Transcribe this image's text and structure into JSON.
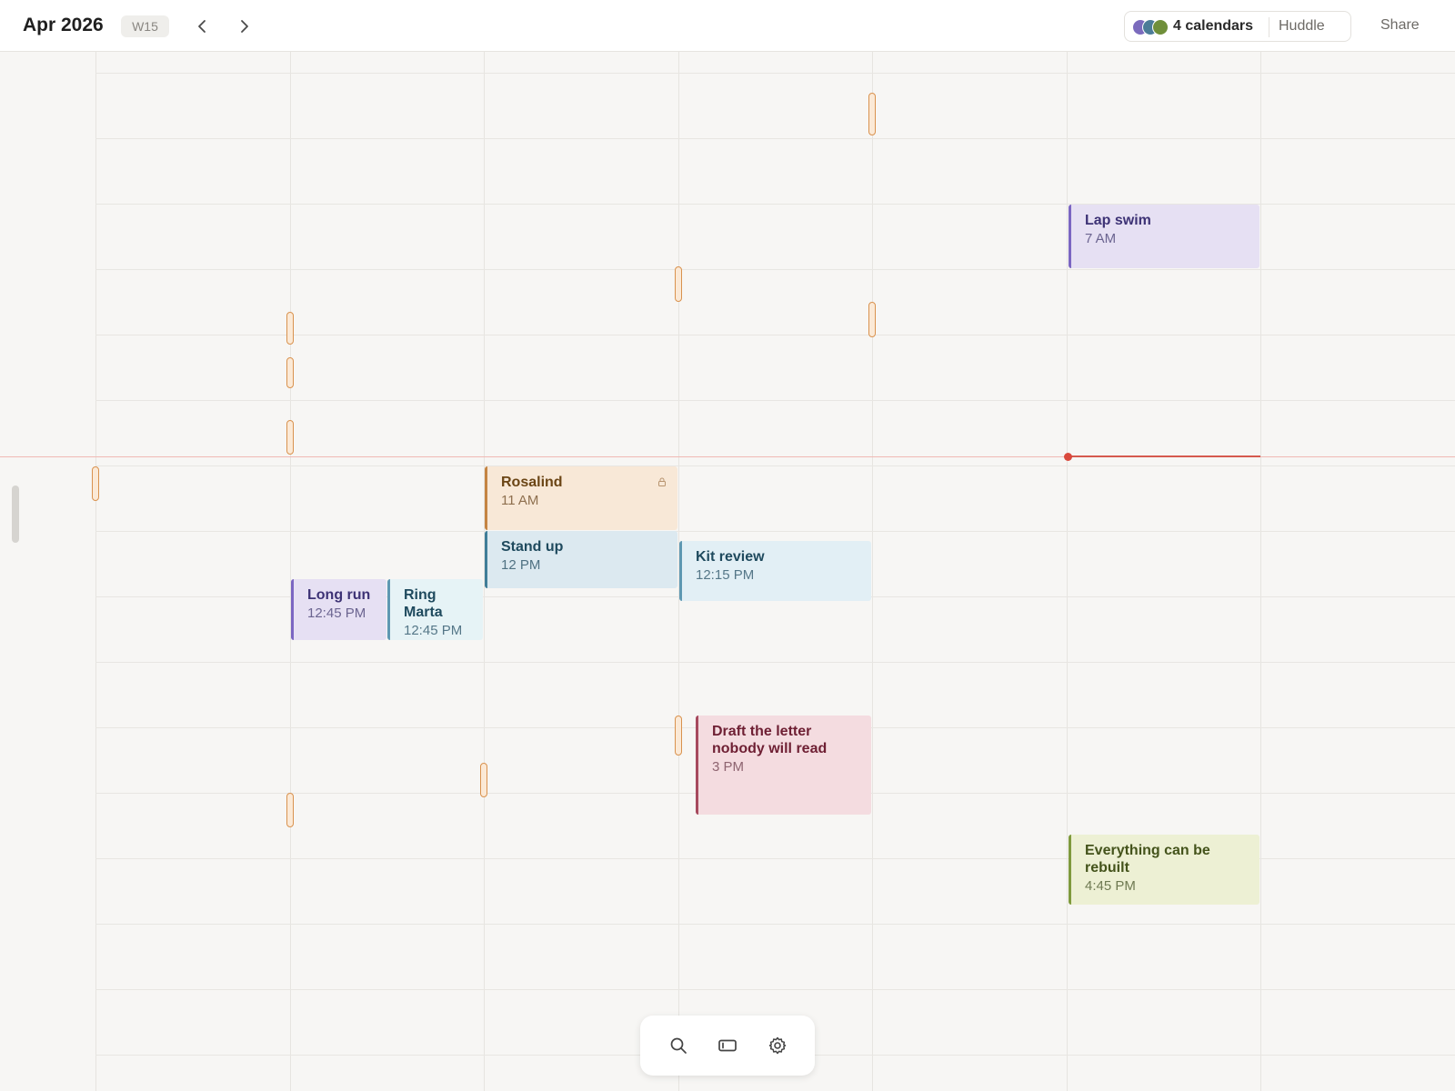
{
  "header": {
    "title": "Apr 2026",
    "week": "W15",
    "calendars_label": "4 calendars",
    "huddle_label": "Huddle",
    "share_label": "Share",
    "calendar_colors": [
      "#7b6bbd",
      "#4b7c98",
      "#6f8f3a"
    ]
  },
  "events": [
    {
      "title": "Lap swim",
      "time": "7 AM"
    },
    {
      "title": "Rosalind",
      "time": "11 AM",
      "locked": true
    },
    {
      "title": "Stand up",
      "time": "12 PM"
    },
    {
      "title": "Kit review",
      "time": "12:15 PM"
    },
    {
      "title": "Long run",
      "time": "12:45 PM"
    },
    {
      "title": "Ring Marta",
      "time": "12:45 PM"
    },
    {
      "title": "Draft the letter nobody will read",
      "time": "3 PM"
    },
    {
      "title": "Everything can be rebuilt",
      "time": "4:45 PM"
    }
  ],
  "colors": {
    "now_indicator": "#d9493c",
    "marker_outline": "#d9924e"
  },
  "toolbar": {
    "icons": [
      "search-icon",
      "panel-icon",
      "gear-icon"
    ]
  }
}
